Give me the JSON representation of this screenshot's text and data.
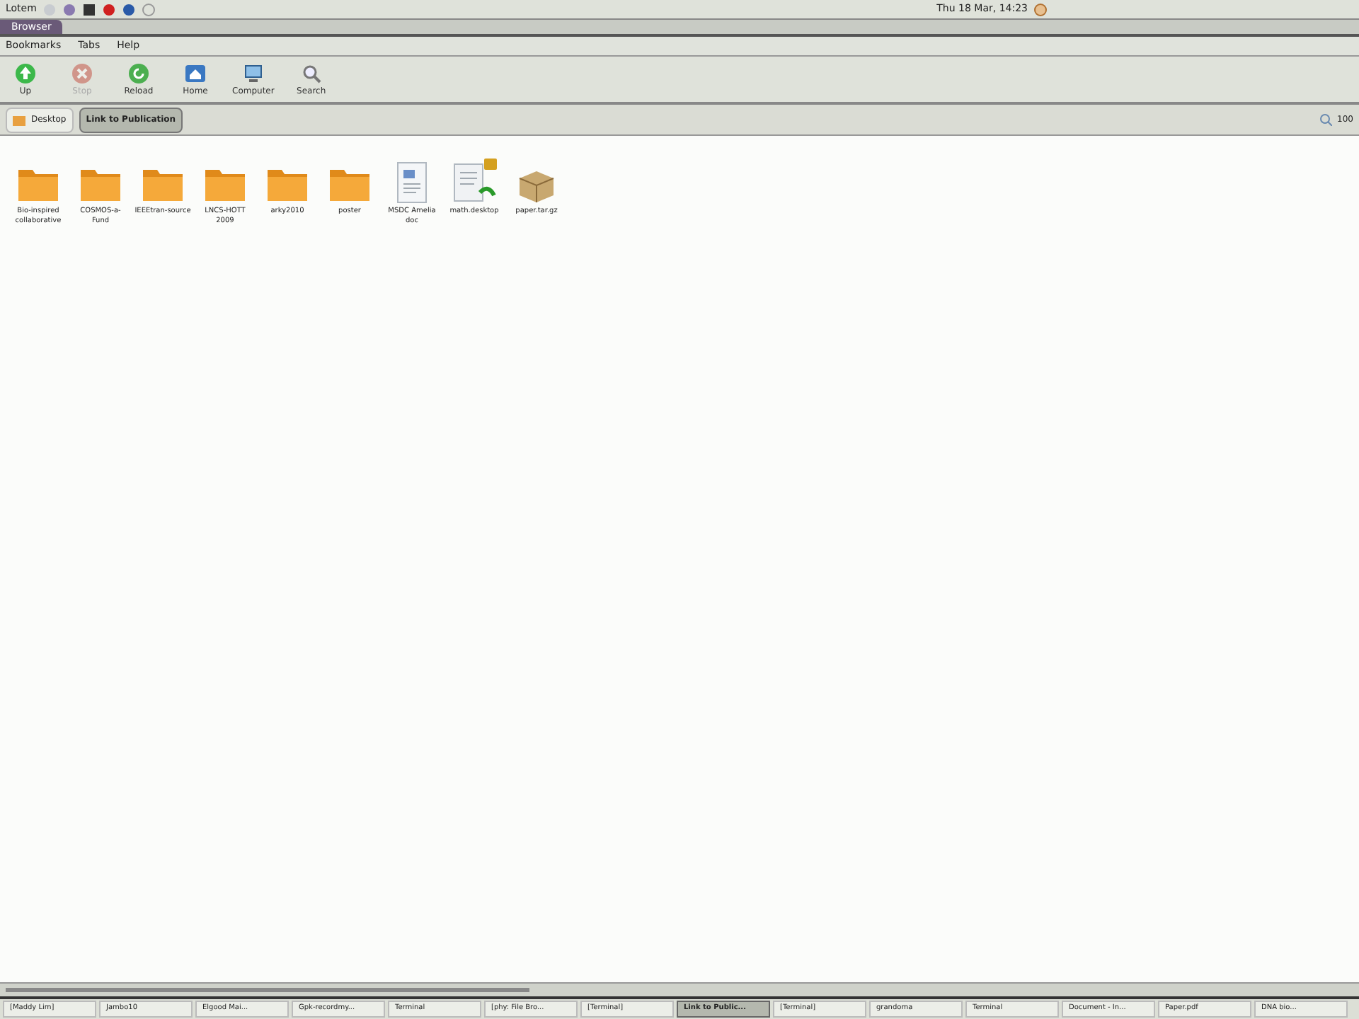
{
  "top_panel": {
    "menu_label": "Lotem",
    "clock": "Thu 18 Mar, 14:23"
  },
  "window": {
    "title": "Browser"
  },
  "menu": [
    "Bookmarks",
    "Tabs",
    "Help"
  ],
  "toolbar": [
    {
      "label": "Up",
      "kind": "up",
      "disabled": false
    },
    {
      "label": "Stop",
      "kind": "stop",
      "disabled": true
    },
    {
      "label": "Reload",
      "kind": "reload",
      "disabled": false
    },
    {
      "label": "Home",
      "kind": "home",
      "disabled": false
    },
    {
      "label": "Computer",
      "kind": "computer",
      "disabled": false
    },
    {
      "label": "Search",
      "kind": "search",
      "disabled": false
    }
  ],
  "path_bar": {
    "crumbs": [
      {
        "label": "Desktop",
        "selected": false
      },
      {
        "label": "Link to Publication",
        "selected": true
      }
    ],
    "zoom": "100"
  },
  "files": [
    {
      "name": "Bio-inspired collaborative",
      "kind": "folder"
    },
    {
      "name": "COSMOS-a-Fund",
      "kind": "folder"
    },
    {
      "name": "IEEEtran-source",
      "kind": "folder"
    },
    {
      "name": "LNCS-HOTT 2009",
      "kind": "folder"
    },
    {
      "name": "arky2010",
      "kind": "folder"
    },
    {
      "name": "poster",
      "kind": "folder"
    },
    {
      "name": "MSDC Amelia doc",
      "kind": "document"
    },
    {
      "name": "math.desktop",
      "kind": "launcher"
    },
    {
      "name": "paper.tar.gz",
      "kind": "archive"
    }
  ],
  "taskbar": [
    {
      "label": "[Maddy Lim]",
      "selected": false
    },
    {
      "label": "Jambo10",
      "selected": false
    },
    {
      "label": "Elgood Mai...",
      "selected": false
    },
    {
      "label": "Gpk-recordmy...",
      "selected": false
    },
    {
      "label": "Terminal",
      "selected": false
    },
    {
      "label": "[phy: File Bro...",
      "selected": false
    },
    {
      "label": "[Terminal]",
      "selected": false
    },
    {
      "label": "Link to Public...",
      "selected": true
    },
    {
      "label": "[Terminal]",
      "selected": false
    },
    {
      "label": "grandoma",
      "selected": false
    },
    {
      "label": "Terminal",
      "selected": false
    },
    {
      "label": "Document - In...",
      "selected": false
    },
    {
      "label": "Paper.pdf",
      "selected": false
    },
    {
      "label": "DNA bio...",
      "selected": false
    }
  ]
}
